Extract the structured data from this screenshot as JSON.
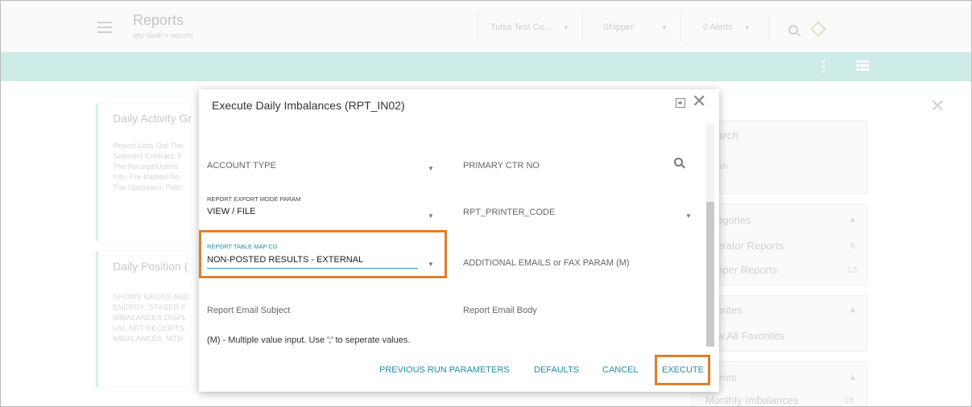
{
  "header": {
    "title": "Reports",
    "breadcrumb": "qtip dash  >  reports",
    "company_select": "Tulsa Test Co...",
    "role_select": "Shipper",
    "alerts_select": "0 Alerts"
  },
  "background": {
    "card1": {
      "title": "Daily Activity Gr",
      "lines": [
        "Report Lists Out The",
        "Selected Contract. F",
        "The Receipt/Upstre",
        "Info. For Pathed No",
        "The Upstream, Path"
      ]
    },
    "card2": {
      "title": "Daily Position (",
      "lines": [
        "SHOWS GROSS AND",
        "ENERGY, STAGED F",
        "IMBALANCES DISPL",
        "L/U, NET RECEIPTS",
        "IMBALANCES, MTD"
      ]
    },
    "sidebar": {
      "search_label": "arch",
      "search_placeholder": "rch",
      "categories_label": "egories",
      "operator_reports": "erator Reports",
      "operator_count": "6",
      "shipper_reports": "pper Reports",
      "shipper_count": "13",
      "favorites_label": "orites",
      "view_all_favorites": "w All Favorites",
      "recents_label": "ents",
      "monthly_imbalances": "Monthly Imbalances",
      "monthly_count": "18"
    }
  },
  "modal": {
    "title": "Execute Daily Imbalances (RPT_IN02)",
    "fields": {
      "account_type_label": "ACCOUNT TYPE",
      "primary_ctr_label": "PRIMARY CTR NO",
      "export_mode_label": "REPORT EXPORT MODE PARAM",
      "export_mode_value": "VIEW / FILE",
      "printer_code_label": "RPT_PRINTER_CODE",
      "table_map_label": "REPORT TABLE MAP CD",
      "table_map_value": "NON-POSTED RESULTS - EXTERNAL",
      "additional_emails_label": "ADDITIONAL EMAILS or FAX PARAM (M)",
      "email_subject_label": "Report Email Subject",
      "email_body_label": "Report Email Body"
    },
    "note": "(M) - Multiple value input. Use ';' to seperate values.",
    "buttons": {
      "previous_run": "PREVIOUS RUN PARAMETERS",
      "defaults": "DEFAULTS",
      "cancel": "CANCEL",
      "execute": "EXECUTE"
    },
    "colors": {
      "accent": "#1e8fa7",
      "highlight": "#e07f2a",
      "underline": "#1e9bd1"
    }
  }
}
